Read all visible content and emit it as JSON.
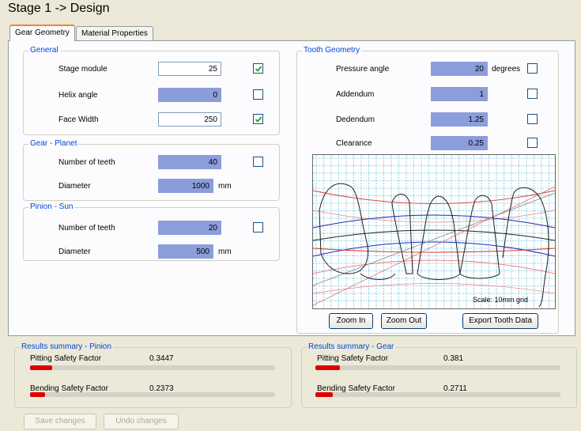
{
  "window": {
    "title": "Stage 1 -> Design"
  },
  "tabs": [
    {
      "label": "Gear Geometry"
    },
    {
      "label": "Material Properties"
    }
  ],
  "general": {
    "heading": "General",
    "stage_module": {
      "label": "Stage module",
      "value": "25",
      "checked": true
    },
    "helix_angle": {
      "label": "Helix angle",
      "value": "0",
      "checked": false
    },
    "face_width": {
      "label": "Face Width",
      "value": "250",
      "checked": true
    }
  },
  "planet": {
    "heading": "Gear - Planet",
    "teeth": {
      "label": "Number of teeth",
      "value": "40",
      "checked": false
    },
    "diameter": {
      "label": "Diameter",
      "value": "1000",
      "unit": "mm"
    }
  },
  "sun": {
    "heading": "Pinion - Sun",
    "teeth": {
      "label": "Number of teeth",
      "value": "20",
      "checked": false
    },
    "diameter": {
      "label": "Diameter",
      "value": "500",
      "unit": "mm"
    }
  },
  "tooth": {
    "heading": "Tooth Geometry",
    "pressure_angle": {
      "label": "Pressure angle",
      "value": "20",
      "unit": "degrees",
      "checked": false
    },
    "addendum": {
      "label": "Addendum",
      "value": "1",
      "checked": false
    },
    "dedendum": {
      "label": "Dedendum",
      "value": "1.25",
      "checked": false
    },
    "clearance": {
      "label": "Clearance",
      "value": "0.25",
      "checked": false
    },
    "plot_scale": "Scale: 10mm grid",
    "zoom_in": "Zoom In",
    "zoom_out": "Zoom Out",
    "export": "Export Tooth Data"
  },
  "results_pinion": {
    "heading": "Results summary - Pinion",
    "pitting": {
      "label": "Pitting Safety Factor",
      "value": "0.3447",
      "fill": 0.09
    },
    "bending": {
      "label": "Bending Safety Factor",
      "value": "0.2373",
      "fill": 0.06
    }
  },
  "results_gear": {
    "heading": "Results summary - Gear",
    "pitting": {
      "label": "Pitting Safety Factor",
      "value": "0.381",
      "fill": 0.1
    },
    "bending": {
      "label": "Bending Safety Factor",
      "value": "0.2711",
      "fill": 0.07
    }
  },
  "actions": {
    "save": "Save changes",
    "undo": "Undo changes"
  },
  "colors": {
    "readonly_field": "#8c9ddc",
    "group_label": "#0046d5",
    "safety_bar": "#e00000",
    "grid": "#6fc6e0"
  }
}
